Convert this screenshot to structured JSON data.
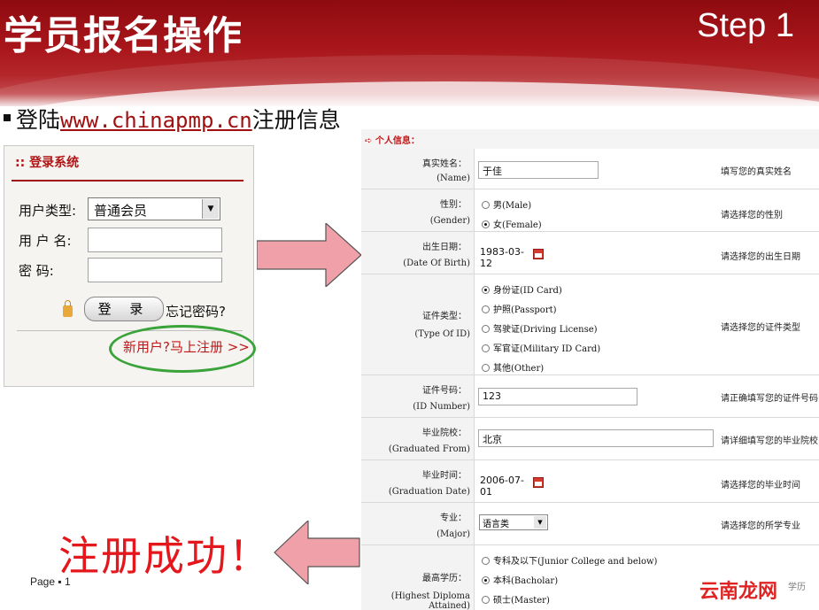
{
  "header": {
    "title": "学员报名操作",
    "step": "Step 1"
  },
  "instruction": {
    "prefix": "登陆",
    "url": "www.chinapmp.cn",
    "suffix": "注册信息"
  },
  "login": {
    "title": ":: 登录系统",
    "user_type_label": "用户类型:",
    "user_type_value": "普通会员",
    "username_label": "用 户 名:",
    "password_label": "密 码:",
    "login_button": "登 录",
    "forgot_link": "忘记密码?",
    "register_link": "新用户?马上注册 >>"
  },
  "success_text": "注册成功！",
  "page_label": "Page ▪ 1",
  "form": {
    "section_title": "➪ 个人信息：",
    "rows": {
      "name": {
        "zh": "真实姓名：",
        "en": "(Name)",
        "value": "于佳",
        "hint": "填写您的真实姓名"
      },
      "gender": {
        "zh": "性别：",
        "en": "(Gender)",
        "options": [
          "男(Male)",
          "女(Female)"
        ],
        "selected": 1,
        "hint": "请选择您的性别"
      },
      "dob": {
        "zh": "出生日期：",
        "en": "(Date Of Birth)",
        "value": "1983-03-12",
        "hint": "请选择您的出生日期"
      },
      "idtype": {
        "zh": "证件类型：",
        "en": "(Type Of ID)",
        "options": [
          "身份证(ID Card)",
          "护照(Passport)",
          "驾驶证(Driving License)",
          "军官证(Military ID Card)",
          "其他(Other)"
        ],
        "selected": 0,
        "hint": "请选择您的证件类型"
      },
      "idnum": {
        "zh": "证件号码：",
        "en": "(ID Number)",
        "value": "123",
        "hint": "请正确填写您的证件号码"
      },
      "school": {
        "zh": "毕业院校：",
        "en": "(Graduated From)",
        "value": "北京",
        "hint": "请详细填写您的毕业院校"
      },
      "gradtime": {
        "zh": "毕业时间：",
        "en": "(Graduation Date)",
        "value": "2006-07-01",
        "hint": "请选择您的毕业时间"
      },
      "major": {
        "zh": "专业：",
        "en": "(Major)",
        "value": "语言类",
        "hint": "请选择您的所学专业"
      },
      "diploma": {
        "zh": "最高学历：",
        "en": "(Highest Diploma Attained)",
        "options": [
          "专科及以下(Junior College and below)",
          "本科(Bacholar)",
          "硕士(Master)"
        ],
        "selected": 1,
        "hint": "学历"
      }
    }
  },
  "watermark": "云南龙网"
}
